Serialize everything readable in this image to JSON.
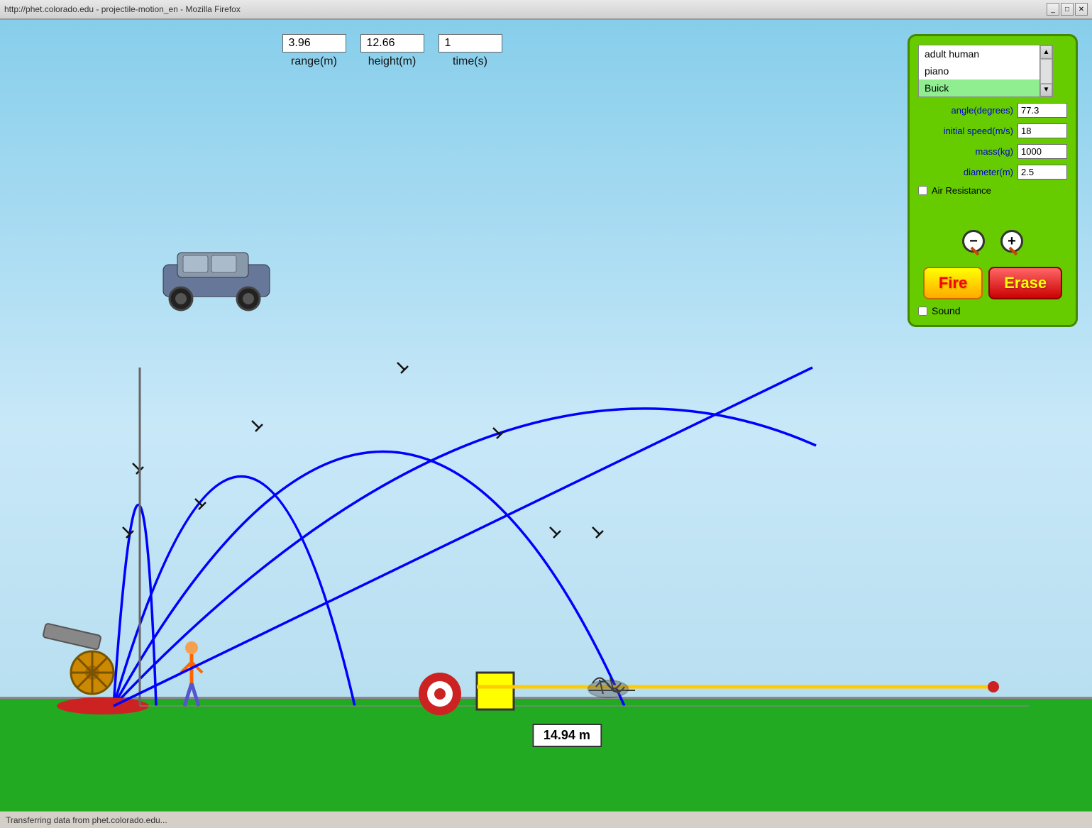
{
  "browser": {
    "title": "http://phet.colorado.edu - projectile-motion_en - Mozilla Firefox",
    "address": "http://phet.colorado.edu - projectile-motion_en - Mozilla Firefox",
    "status": "Transferring data from phet.colorado.edu..."
  },
  "stats": {
    "range_value": "3.96",
    "range_label": "range(m)",
    "height_value": "12.66",
    "height_label": "height(m)",
    "time_value": "1",
    "time_label": "time(s)"
  },
  "controls": {
    "projectiles": [
      {
        "label": "adult human",
        "selected": false
      },
      {
        "label": "piano",
        "selected": false
      },
      {
        "label": "Buick",
        "selected": true
      }
    ],
    "angle_label": "angle(degrees)",
    "angle_value": "77.3",
    "speed_label": "initial speed(m/s)",
    "speed_value": "18",
    "mass_label": "mass(kg)",
    "mass_value": "1000",
    "diameter_label": "diameter(m)",
    "diameter_value": "2.5",
    "air_resistance_label": "Air Resistance",
    "air_resistance_checked": false,
    "zoom_out_label": "−",
    "zoom_in_label": "+",
    "fire_label": "Fire",
    "erase_label": "Erase",
    "sound_label": "Sound",
    "sound_checked": false
  },
  "simulation": {
    "distance_label": "14.94 m"
  }
}
